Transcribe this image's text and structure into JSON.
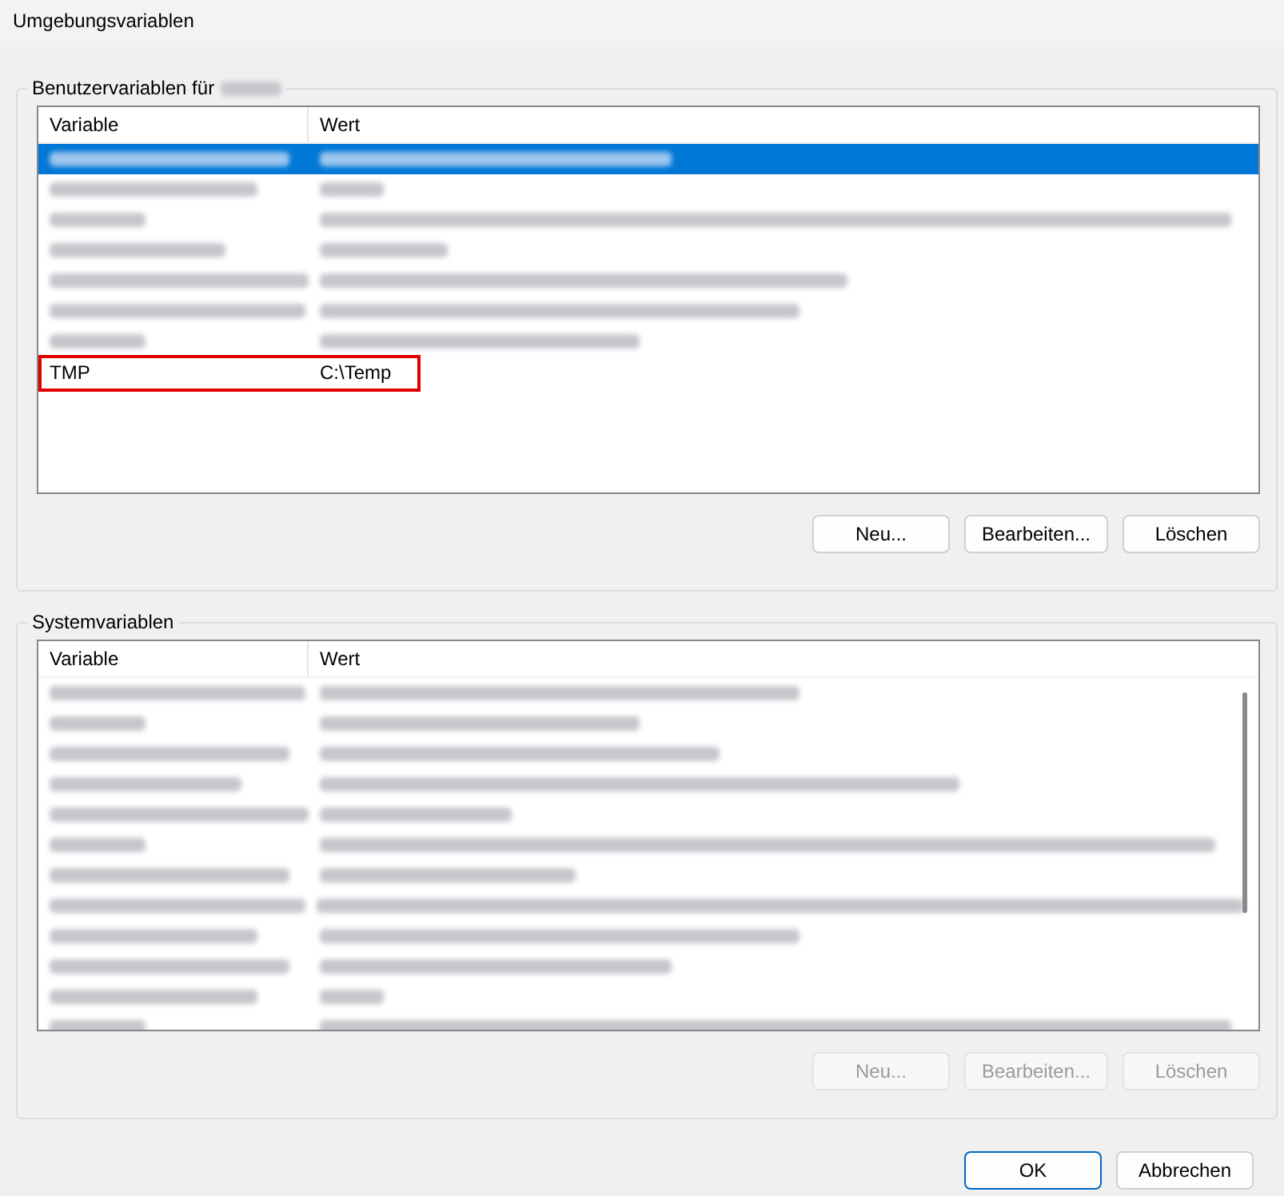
{
  "window": {
    "title": "Umgebungsvariablen"
  },
  "groups": [
    {
      "title": "Benutzervariablen für",
      "title_redacted": true,
      "columns": [
        "Variable",
        "Wert"
      ],
      "scrollbar": false,
      "rows": [
        {
          "kind": "redacted",
          "selected": true,
          "highlighted": false
        },
        {
          "kind": "redacted",
          "selected": false,
          "highlighted": false
        },
        {
          "kind": "redacted",
          "selected": false,
          "highlighted": false
        },
        {
          "kind": "redacted",
          "selected": false,
          "highlighted": false
        },
        {
          "kind": "redacted",
          "selected": false,
          "highlighted": false
        },
        {
          "kind": "redacted",
          "selected": false,
          "highlighted": false
        },
        {
          "kind": "redacted",
          "selected": false,
          "highlighted": false
        },
        {
          "kind": "text",
          "variable": "TMP",
          "value": "C:\\Temp",
          "selected": false,
          "highlighted": true
        }
      ],
      "buttons": [
        {
          "label": "Neu...",
          "disabled": false
        },
        {
          "label": "Bearbeiten...",
          "disabled": false
        },
        {
          "label": "Löschen",
          "disabled": false
        }
      ]
    },
    {
      "title": "Systemvariablen",
      "title_redacted": false,
      "columns": [
        "Variable",
        "Wert"
      ],
      "scrollbar": true,
      "rows": [
        {
          "kind": "redacted",
          "selected": false,
          "highlighted": false
        },
        {
          "kind": "redacted",
          "selected": false,
          "highlighted": false
        },
        {
          "kind": "redacted",
          "selected": false,
          "highlighted": false
        },
        {
          "kind": "redacted",
          "selected": false,
          "highlighted": false
        },
        {
          "kind": "redacted",
          "selected": false,
          "highlighted": false
        },
        {
          "kind": "redacted",
          "selected": false,
          "highlighted": false
        },
        {
          "kind": "redacted",
          "selected": false,
          "highlighted": false
        },
        {
          "kind": "redacted",
          "selected": false,
          "highlighted": false
        },
        {
          "kind": "redacted",
          "selected": false,
          "highlighted": false
        },
        {
          "kind": "redacted",
          "selected": false,
          "highlighted": false
        },
        {
          "kind": "redacted",
          "selected": false,
          "highlighted": false
        },
        {
          "kind": "redacted",
          "selected": false,
          "highlighted": false
        }
      ],
      "buttons": [
        {
          "label": "Neu...",
          "disabled": true
        },
        {
          "label": "Bearbeiten...",
          "disabled": true
        },
        {
          "label": "Löschen",
          "disabled": true
        }
      ]
    }
  ],
  "dialog_buttons": [
    {
      "label": "OK",
      "default": true
    },
    {
      "label": "Abbrechen",
      "default": false
    }
  ]
}
